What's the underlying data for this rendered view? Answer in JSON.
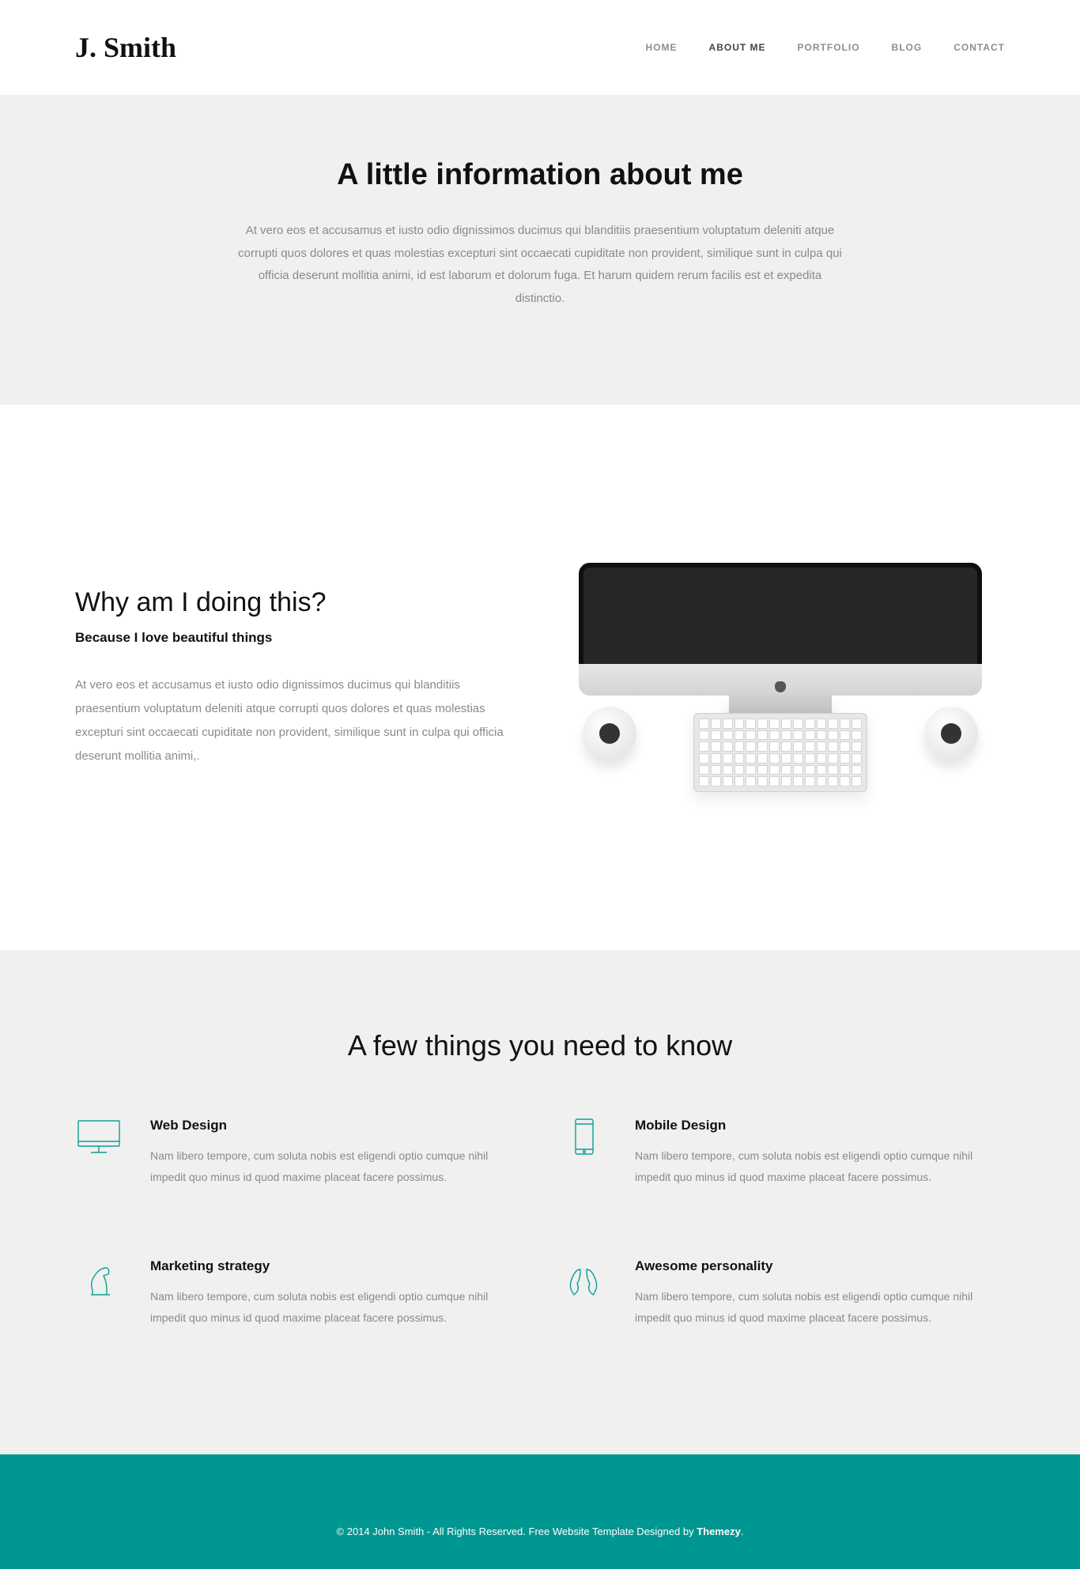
{
  "header": {
    "logo": "J. Smith",
    "nav": [
      {
        "label": "HOME"
      },
      {
        "label": "ABOUT ME"
      },
      {
        "label": "PORTFOLIO"
      },
      {
        "label": "BLOG"
      },
      {
        "label": "CONTACT"
      }
    ]
  },
  "hero": {
    "title": "A little information about me",
    "body": "At vero eos et accusamus et iusto odio dignissimos ducimus qui blanditiis praesentium voluptatum deleniti atque corrupti quos dolores et quas molestias excepturi sint occaecati cupiditate non provident, similique sunt in culpa qui officia deserunt mollitia animi, id est laborum et dolorum fuga. Et harum quidem rerum facilis est et expedita distinctio."
  },
  "why": {
    "title": "Why am I doing this?",
    "subtitle": "Because I love beautiful things",
    "body": "At vero eos et accusamus et iusto odio dignissimos ducimus qui blanditiis praesentium voluptatum deleniti atque corrupti quos dolores et quas molestias excepturi sint occaecati cupiditate non provident, similique sunt in culpa qui officia deserunt mollitia animi,."
  },
  "skills": {
    "title": "A few things you need to know",
    "items": [
      {
        "name": "Web Design",
        "body": "Nam libero tempore, cum soluta nobis est eligendi optio cumque nihil impedit quo minus id quod maxime placeat facere possimus."
      },
      {
        "name": "Mobile Design",
        "body": "Nam libero tempore, cum soluta nobis est eligendi optio cumque nihil impedit quo minus id quod maxime placeat facere possimus."
      },
      {
        "name": "Marketing strategy",
        "body": "Nam libero tempore, cum soluta nobis est eligendi optio cumque nihil impedit quo minus id quod maxime placeat facere possimus."
      },
      {
        "name": "Awesome personality",
        "body": "Nam libero tempore, cum soluta nobis est eligendi optio cumque nihil impedit quo minus id quod maxime placeat facere possimus."
      }
    ]
  },
  "footer": {
    "text": "© 2014 John Smith - All Rights Reserved. Free Website Template Designed by ",
    "link": "Themezy",
    "suffix": "."
  }
}
